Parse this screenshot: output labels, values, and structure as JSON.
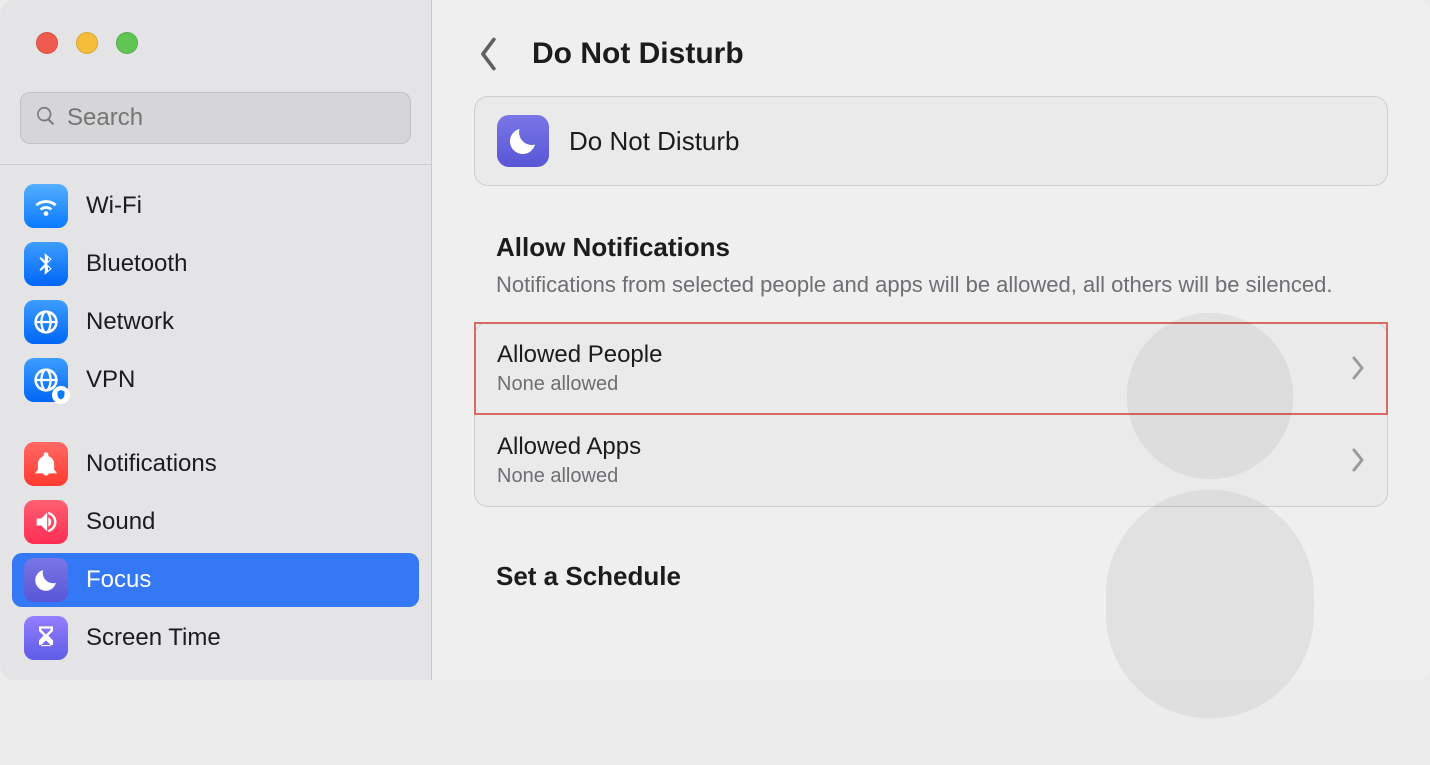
{
  "window": {
    "title": "Do Not Disturb"
  },
  "search": {
    "placeholder": "Search"
  },
  "sidebar": {
    "groups": [
      [
        {
          "label": "Wi-Fi"
        },
        {
          "label": "Bluetooth"
        },
        {
          "label": "Network"
        },
        {
          "label": "VPN"
        }
      ],
      [
        {
          "label": "Notifications"
        },
        {
          "label": "Sound"
        },
        {
          "label": "Focus"
        },
        {
          "label": "Screen Time"
        }
      ]
    ]
  },
  "hero": {
    "label": "Do Not Disturb"
  },
  "allow": {
    "title": "Allow Notifications",
    "subtitle": "Notifications from selected people and apps will be allowed, all others will be silenced.",
    "rows": [
      {
        "title": "Allowed People",
        "sub": "None allowed"
      },
      {
        "title": "Allowed Apps",
        "sub": "None allowed"
      }
    ]
  },
  "schedule": {
    "title": "Set a Schedule"
  }
}
